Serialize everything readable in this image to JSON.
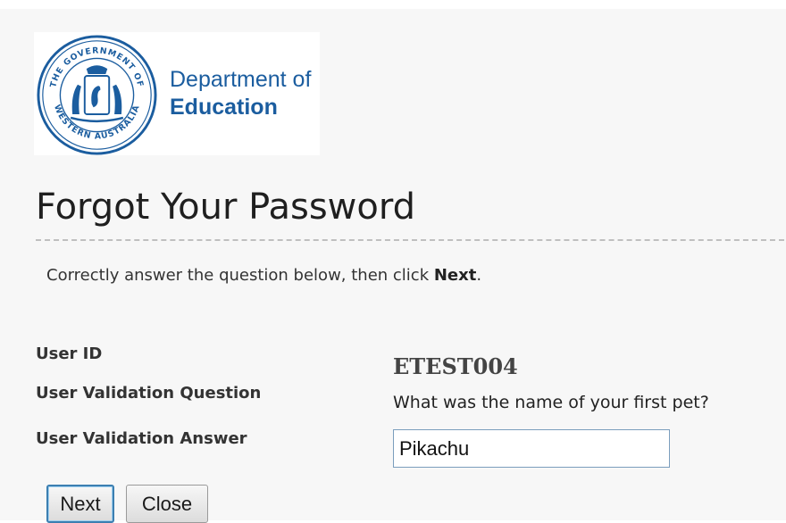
{
  "header": {
    "seal_outer_text": "THE GOVERNMENT OF WESTERN AUSTRALIA",
    "department_line1": "Department of",
    "department_line2": "Education"
  },
  "page": {
    "title": "Forgot Your Password",
    "instructions_prefix": "Correctly answer the question below, then click ",
    "instructions_emphasis": "Next",
    "instructions_suffix": "."
  },
  "form": {
    "user_id_label": "User ID",
    "user_id_value": "ETEST004",
    "question_label": "User Validation Question",
    "question_value": "What was the name of your first pet?",
    "answer_label": "User Validation Answer",
    "answer_value": "Pikachu"
  },
  "buttons": {
    "next_label": "Next",
    "close_label": "Close"
  },
  "colors": {
    "brand_blue": "#1b5d9f",
    "page_background": "#f7f7f7",
    "input_border": "#7b9ebd",
    "default_button_border": "#3c7fb1"
  }
}
